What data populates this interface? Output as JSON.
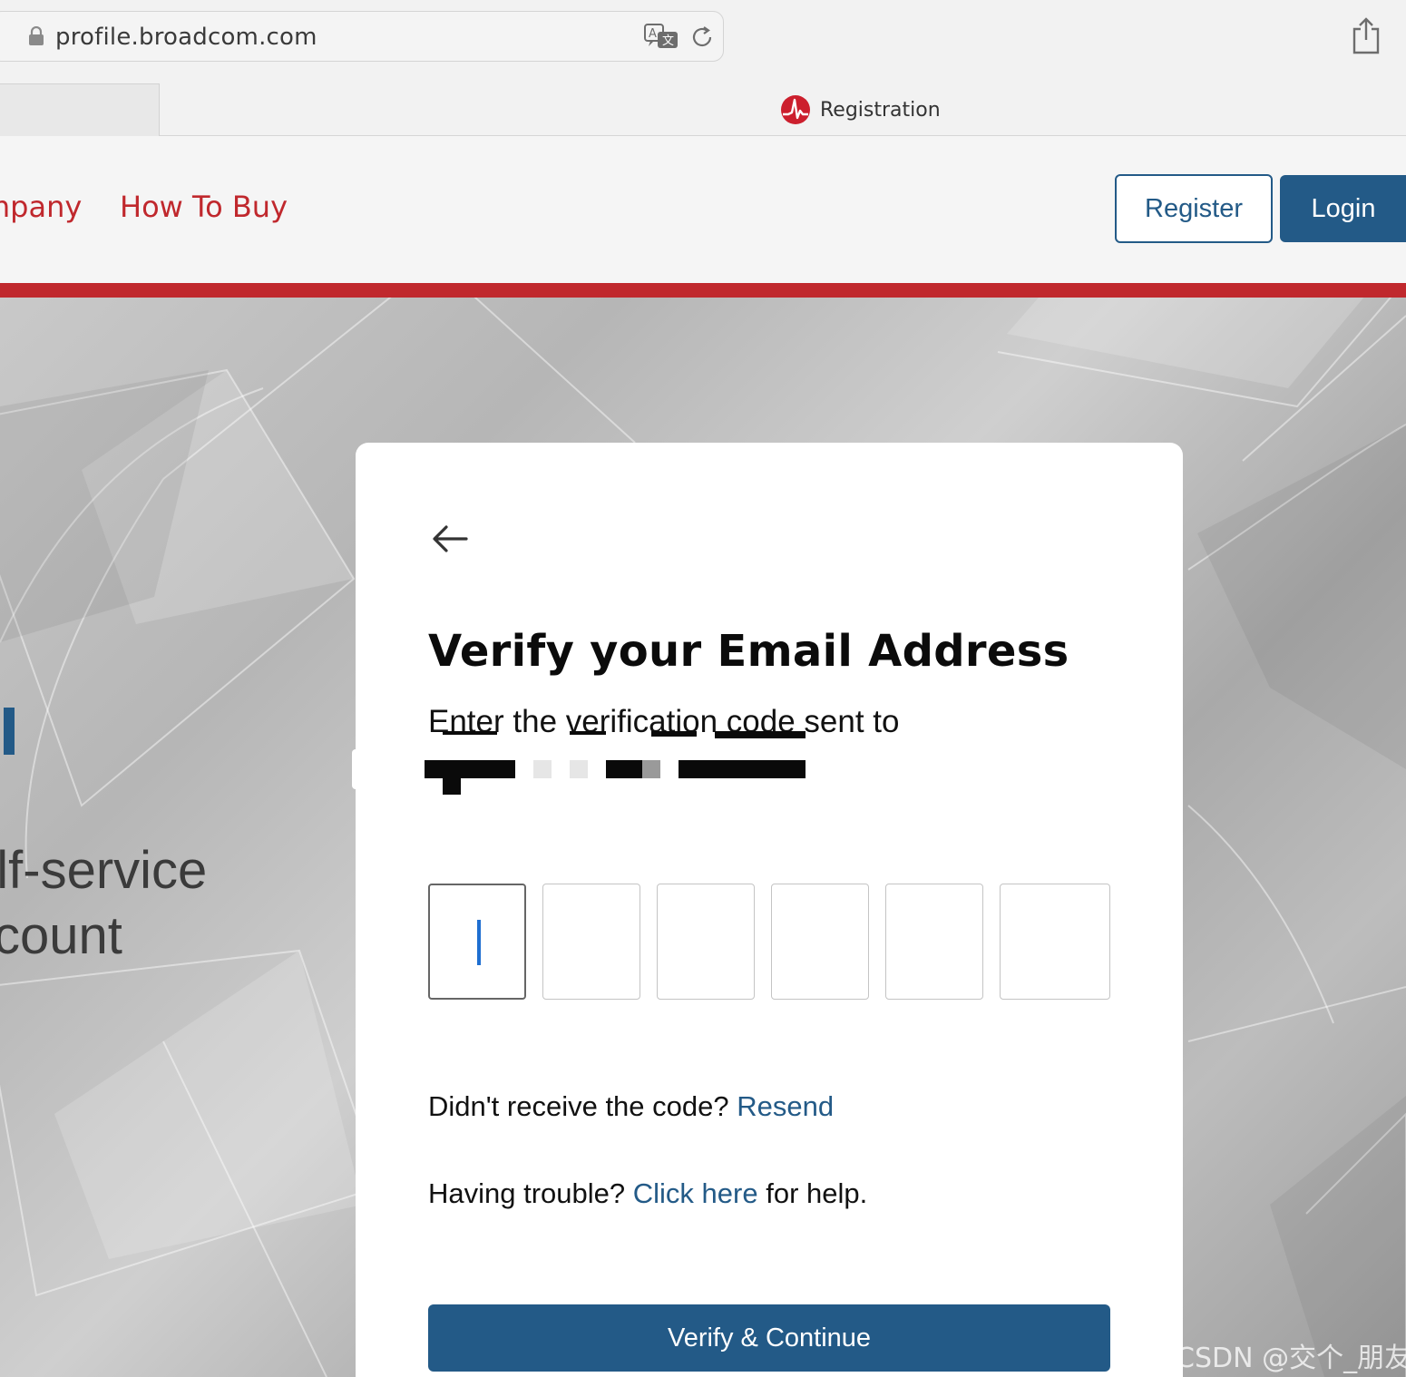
{
  "browser": {
    "url": "profile.broadcom.com",
    "tab_title": "Registration"
  },
  "header": {
    "nav": [
      {
        "label": "mpany"
      },
      {
        "label": "How To Buy"
      }
    ],
    "register_label": "Register",
    "login_label": "Login"
  },
  "hero": {
    "line1": "elf-service",
    "line2": "ccount"
  },
  "card": {
    "title": "Verify your Email Address",
    "subtitle": "Enter the verification code sent to",
    "code_digits": [
      "",
      "",
      "",
      "",
      "",
      ""
    ],
    "resend_prompt": "Didn't receive the code?",
    "resend_link": "Resend",
    "help_prompt": "Having trouble?",
    "help_link": "Click here",
    "help_suffix": "for help.",
    "submit_label": "Verify & Continue"
  },
  "watermark": "CSDN @交个_朋友",
  "colors": {
    "brand_red": "#c0282d",
    "brand_blue": "#235a87",
    "caret": "#1f6fd1"
  }
}
